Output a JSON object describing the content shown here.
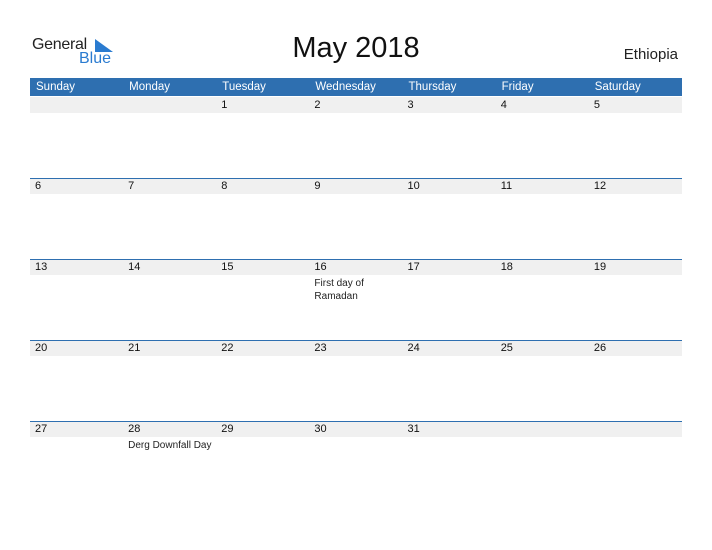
{
  "logo": {
    "general": "General",
    "blue": "Blue"
  },
  "title": "May 2018",
  "country": "Ethiopia",
  "colors": {
    "header_bg": "#2e6fb0",
    "logo_blue": "#2a7bd0",
    "day_row_bg": "#f0f0f0"
  },
  "weekdays": [
    "Sunday",
    "Monday",
    "Tuesday",
    "Wednesday",
    "Thursday",
    "Friday",
    "Saturday"
  ],
  "weeks": [
    {
      "days": [
        {
          "num": "",
          "ev": ""
        },
        {
          "num": "",
          "ev": ""
        },
        {
          "num": "1",
          "ev": ""
        },
        {
          "num": "2",
          "ev": ""
        },
        {
          "num": "3",
          "ev": ""
        },
        {
          "num": "4",
          "ev": ""
        },
        {
          "num": "5",
          "ev": ""
        }
      ]
    },
    {
      "days": [
        {
          "num": "6",
          "ev": ""
        },
        {
          "num": "7",
          "ev": ""
        },
        {
          "num": "8",
          "ev": ""
        },
        {
          "num": "9",
          "ev": ""
        },
        {
          "num": "10",
          "ev": ""
        },
        {
          "num": "11",
          "ev": ""
        },
        {
          "num": "12",
          "ev": ""
        }
      ]
    },
    {
      "days": [
        {
          "num": "13",
          "ev": ""
        },
        {
          "num": "14",
          "ev": ""
        },
        {
          "num": "15",
          "ev": ""
        },
        {
          "num": "16",
          "ev": "First day of Ramadan"
        },
        {
          "num": "17",
          "ev": ""
        },
        {
          "num": "18",
          "ev": ""
        },
        {
          "num": "19",
          "ev": ""
        }
      ]
    },
    {
      "days": [
        {
          "num": "20",
          "ev": ""
        },
        {
          "num": "21",
          "ev": ""
        },
        {
          "num": "22",
          "ev": ""
        },
        {
          "num": "23",
          "ev": ""
        },
        {
          "num": "24",
          "ev": ""
        },
        {
          "num": "25",
          "ev": ""
        },
        {
          "num": "26",
          "ev": ""
        }
      ]
    },
    {
      "days": [
        {
          "num": "27",
          "ev": ""
        },
        {
          "num": "28",
          "ev": "Derg Downfall Day"
        },
        {
          "num": "29",
          "ev": ""
        },
        {
          "num": "30",
          "ev": ""
        },
        {
          "num": "31",
          "ev": ""
        },
        {
          "num": "",
          "ev": ""
        },
        {
          "num": "",
          "ev": ""
        }
      ]
    }
  ]
}
